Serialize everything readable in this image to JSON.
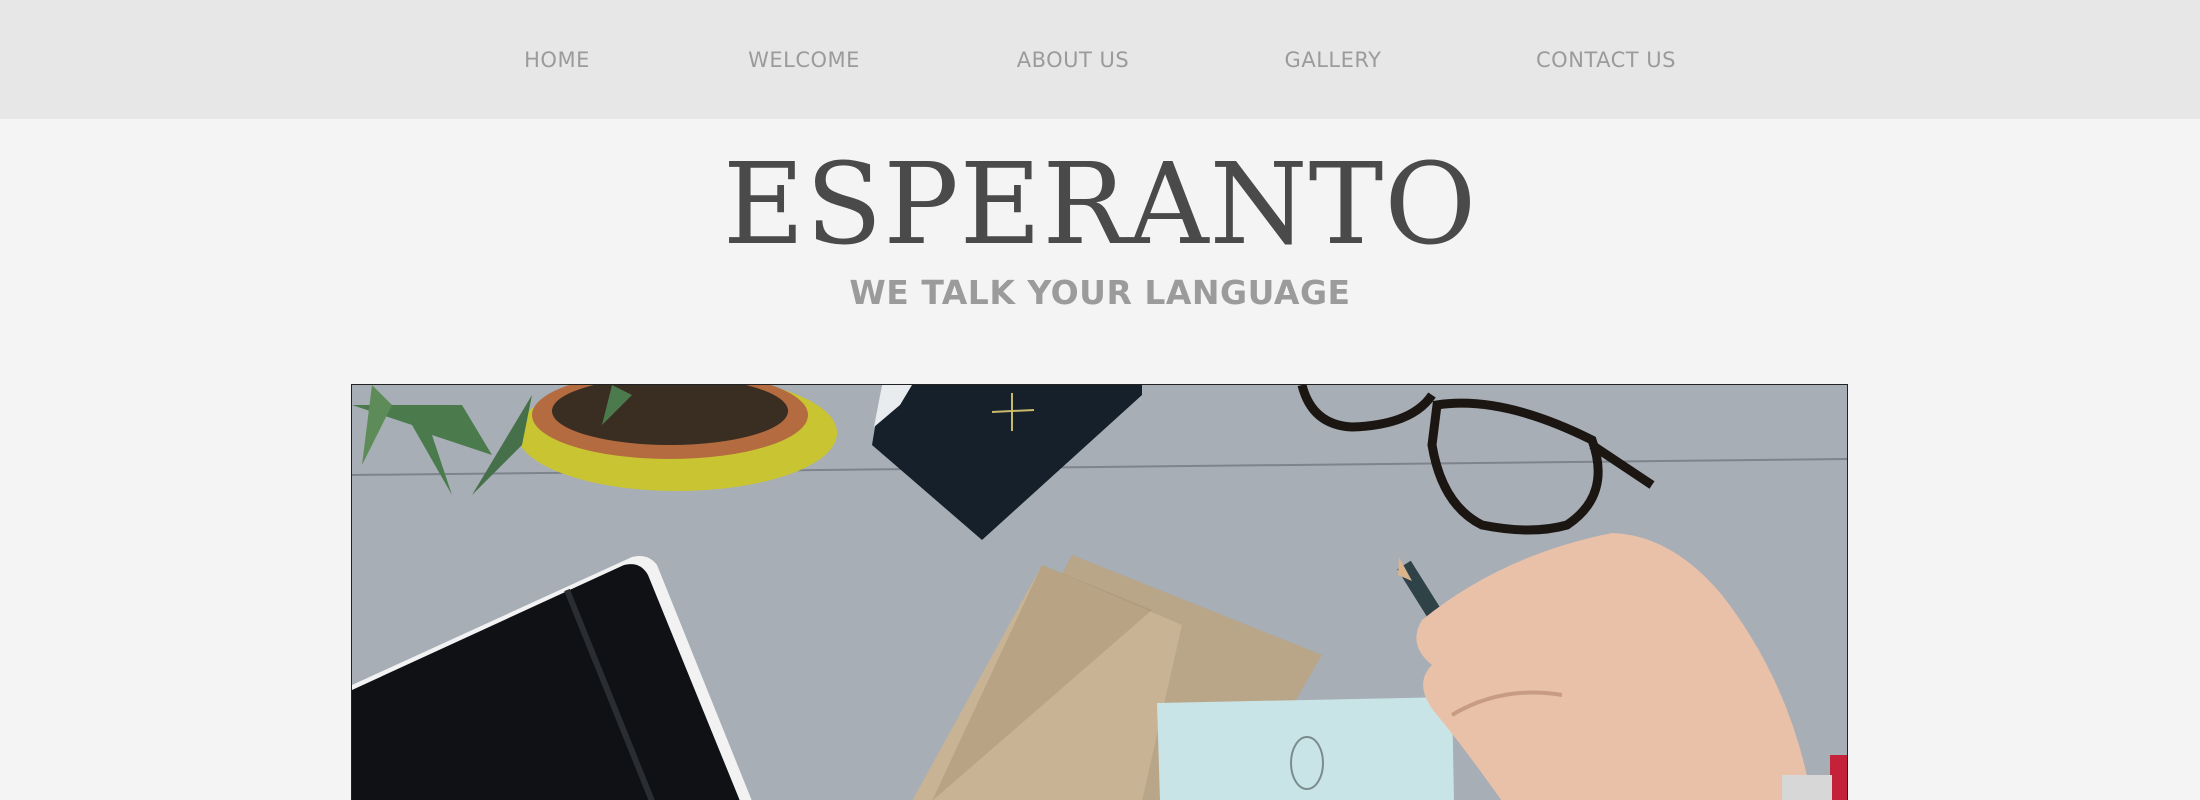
{
  "nav": {
    "items": [
      {
        "label": "HOME"
      },
      {
        "label": "WELCOME"
      },
      {
        "label": "ABOUT US"
      },
      {
        "label": "GALLERY"
      },
      {
        "label": "CONTACT US"
      }
    ]
  },
  "header": {
    "title": "ESPERANTO",
    "tagline": "WE TALK YOUR LANGUAGE"
  },
  "hero": {
    "image": "desk-flatlay-photo"
  },
  "colors": {
    "nav_bg": "#e7e7e7",
    "page_bg": "#f4f4f4",
    "nav_text": "#9b9b9b",
    "title_text": "#4a4a4a"
  }
}
